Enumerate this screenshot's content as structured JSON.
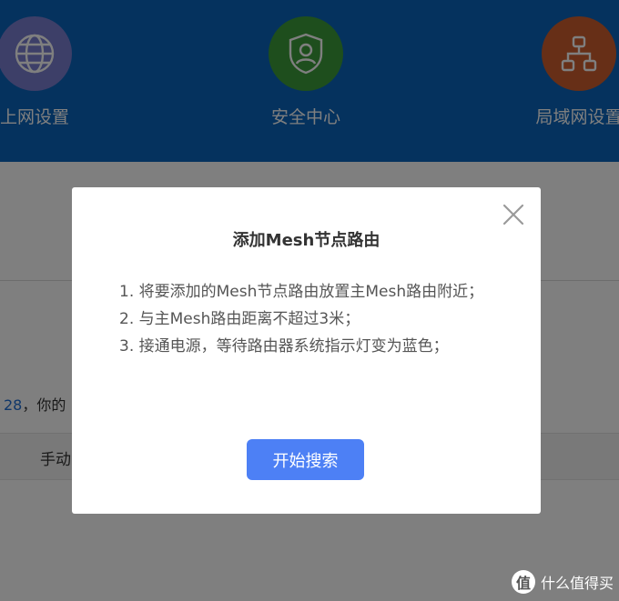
{
  "top_nav": {
    "items": [
      {
        "label": "上网设置",
        "icon": "globe-icon",
        "color": "#7b7fd0"
      },
      {
        "label": "安全中心",
        "icon": "shield-user-icon",
        "color": "#3c9d3a"
      },
      {
        "label": "局域网设置",
        "icon": "network-tree-icon",
        "color": "#cf5f2e"
      }
    ]
  },
  "background_page": {
    "partial_number": "28",
    "partial_text": "，你的",
    "table_header_partial": "手动"
  },
  "modal": {
    "title": "添加Mesh节点路由",
    "lines": [
      "1. 将要添加的Mesh节点路由放置主Mesh路由附近；",
      "2. 与主Mesh路由距离不超过3米；",
      "3. 接通电源，等待路由器系统指示灯变为蓝色；"
    ],
    "button_label": "开始搜索",
    "close_icon": "close-icon"
  },
  "watermark": {
    "logo_glyph": "值",
    "text": "什么值得买"
  },
  "colors": {
    "header_blue": "#0a64bc",
    "button_blue": "#4d80f5",
    "link_blue": "#1f6ed4"
  }
}
